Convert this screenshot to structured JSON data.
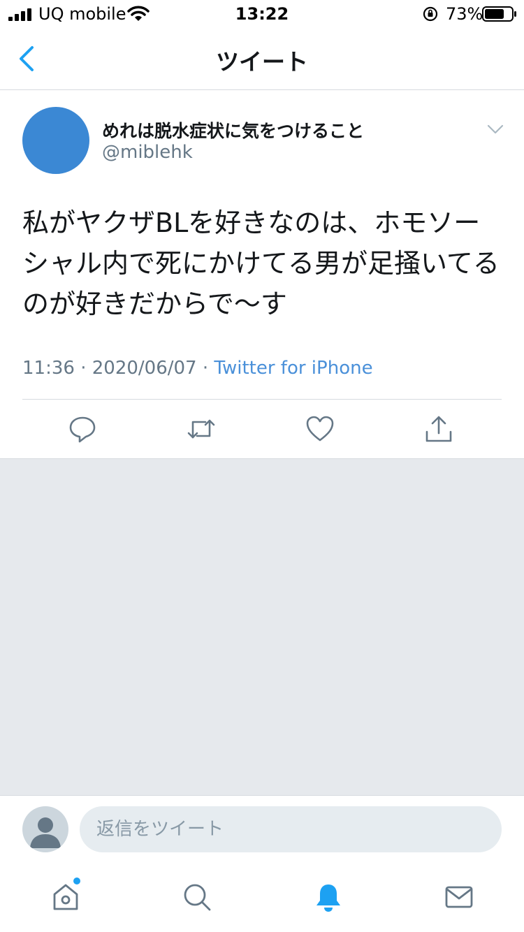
{
  "status_bar": {
    "carrier": "UQ mobile",
    "time": "13:22",
    "battery_percent": "73%",
    "battery_level": 0.73
  },
  "header": {
    "title": "ツイート",
    "back_icon": "chevron-left-icon"
  },
  "tweet": {
    "author_name": "めれは脱水症状に気をつけること",
    "author_handle": "@miblehk",
    "text": "私がヤクザBLを好きなのは、ホモソーシャル内で死にかけてる男が足掻いてるのが好きだからで〜す",
    "time": "11:36",
    "date": "2020/06/07",
    "separator": "·",
    "source": "Twitter for iPhone"
  },
  "actions": [
    {
      "name": "reply",
      "icon": "reply-icon"
    },
    {
      "name": "retweet",
      "icon": "retweet-icon"
    },
    {
      "name": "like",
      "icon": "heart-icon"
    },
    {
      "name": "share",
      "icon": "share-icon"
    }
  ],
  "reply": {
    "placeholder": "返信をツイート"
  },
  "tab_bar": {
    "items": [
      "home-icon",
      "search-icon",
      "bell-icon",
      "mail-icon"
    ],
    "active": "bell-icon",
    "home_has_new": true
  },
  "colors": {
    "accent": "#1da1f2",
    "link": "#4a90d9",
    "avatar": "#3b88d4",
    "muted": "#657786",
    "background_gray": "#e6e9ed"
  }
}
